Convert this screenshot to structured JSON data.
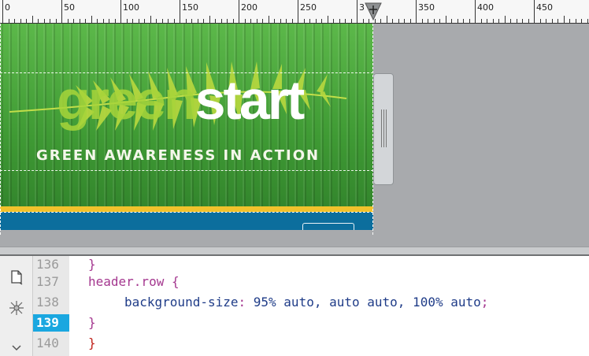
{
  "ruler": {
    "labels": [
      "0",
      "50",
      "100",
      "150",
      "200",
      "250",
      "3",
      "350",
      "400",
      "450"
    ]
  },
  "banner": {
    "logo_green": "green",
    "logo_start": "start",
    "tagline": "GREEN AWARENESS IN ACTION"
  },
  "code": {
    "line_numbers": [
      "136",
      "137",
      "138",
      "139",
      "140"
    ],
    "active_line": "139",
    "lines": {
      "l136": "}",
      "l137_selector": "header.row",
      "l137_brace": " {",
      "l138_prop": "background-size",
      "l138_colon": ": ",
      "l138_value": "95% auto, auto auto, 100% auto",
      "l138_semi": ";",
      "l139": "}",
      "l140": "}"
    }
  },
  "colors": {
    "accent": "#1aa7e0",
    "banner_blue": "#0c6e9d",
    "banner_yellow": "#f1c22c"
  }
}
